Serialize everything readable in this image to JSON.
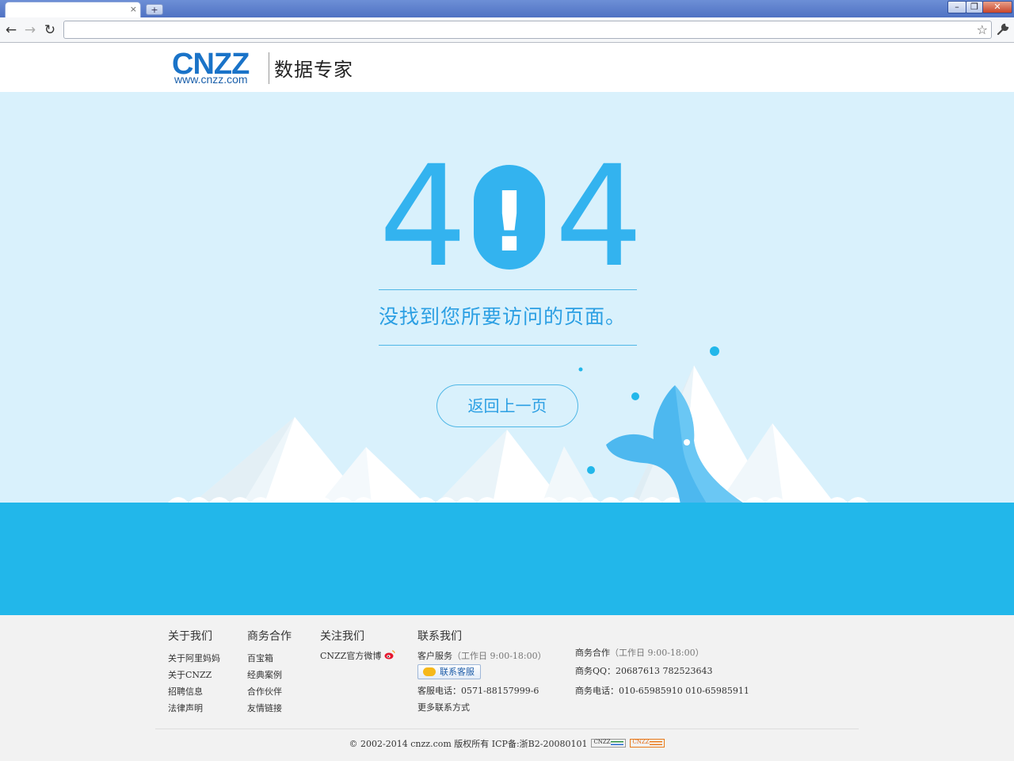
{
  "browser": {
    "tab_close": "×",
    "new_tab": "+",
    "win_min": "–",
    "win_restore": "❐",
    "win_close": "✕",
    "nav_back": "←",
    "nav_forward": "→",
    "nav_reload": "↻",
    "address_value": "",
    "star": "☆",
    "wrench": "🔧"
  },
  "header": {
    "logo_mark": "CNZZ",
    "logo_url": "www.cnzz.com",
    "logo_cn": "数据专家"
  },
  "error": {
    "code_left": "4",
    "code_middle": "!",
    "code_right": "4",
    "message": "没找到您所要访问的页面。",
    "back_button": "返回上一页"
  },
  "colors": {
    "accent": "#2b9fe3",
    "sky": "#d9f1fc",
    "sea": "#22b7ea",
    "digits": "#33b3ef"
  },
  "footer": {
    "about": {
      "title": "关于我们",
      "links": [
        "关于阿里妈妈",
        "关于CNZZ",
        "招聘信息",
        "法律声明"
      ]
    },
    "business": {
      "title": "商务合作",
      "links": [
        "百宝箱",
        "经典案例",
        "合作伙伴",
        "友情链接"
      ]
    },
    "follow": {
      "title": "关注我们",
      "weibo": "CNZZ官方微博",
      "weibo_icon": "weibo-icon"
    },
    "contact": {
      "title": "联系我们",
      "customer_service": "客户服务",
      "customer_hours": "（工作日 9:00-18:00）",
      "kefu_button": "联系客服",
      "phone": "客服电话：0571-88157999-6",
      "more": "更多联系方式",
      "biz": "商务合作",
      "biz_hours": "（工作日 9:00-18:00）",
      "biz_qq": "商务QQ：20687613 782523643",
      "biz_phone": "商务电话：010-65985910 010-65985911"
    },
    "copyright": "© 2002-2014 cnzz.com 版权所有 ICP备:浙B2-20080101",
    "badge1": "CNZZ",
    "badge2": "CNZZ"
  }
}
